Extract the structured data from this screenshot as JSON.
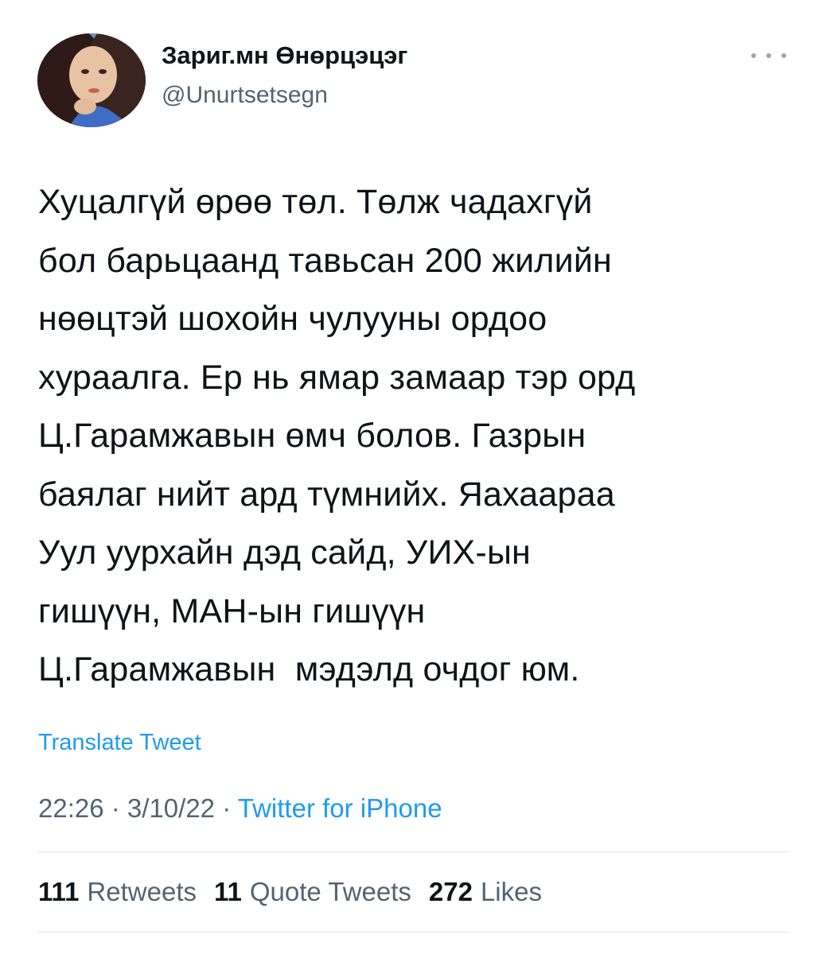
{
  "author": {
    "display_name": "Зариг.мн Өнөрцэцэг",
    "handle": "@Unurtsetsegn"
  },
  "tweet": {
    "lines": [
      "Хуцалгүй өрөө төл. Төлж чадахгүй",
      "бол барьцаанд тавьсан 200 жилийн",
      "нөөцтэй шохойн чулууны ордоо",
      "хураалга. Ер нь ямар замаар тэр орд",
      "Ц.Гарамжавын өмч болов. Газрын",
      "баялаг нийт ард түмнийх. Яахаараа",
      "Уул уурхайн дэд сайд, УИХ-ын",
      "гишүүн, МАН-ын гишүүн",
      "Ц.Гарамжавын  мэдэлд очдог юм."
    ],
    "translate_label": "Translate Tweet",
    "time": "22:26",
    "date": "3/10/22",
    "separator": " · ",
    "source": "Twitter for iPhone"
  },
  "stats": {
    "retweets_count": "111",
    "retweets_label": "Retweets",
    "quotes_count": "11",
    "quotes_label": "Quote Tweets",
    "likes_count": "272",
    "likes_label": "Likes"
  },
  "colors": {
    "text": "#0f1419",
    "secondary": "#536471",
    "accent": "#1d9bf0",
    "divider": "#dfe3e6"
  },
  "icons": {
    "more": "more-horizontal-icon"
  }
}
